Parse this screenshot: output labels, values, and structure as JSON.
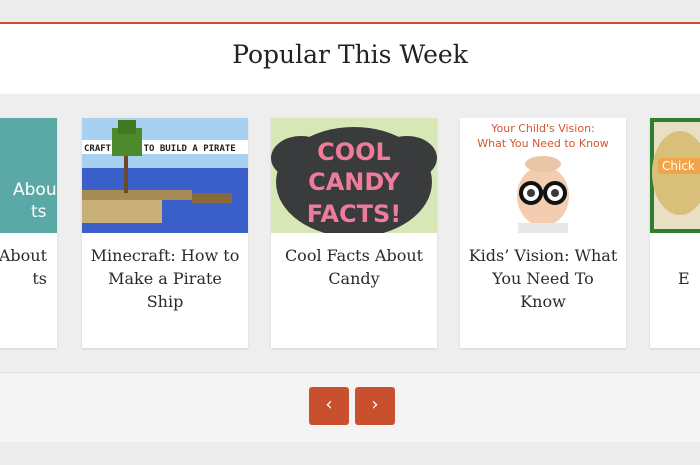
{
  "widget": {
    "title": "Popular This Week",
    "accent_color": "#c8502e"
  },
  "cards": [
    {
      "title": "... About ...ts",
      "thumb_text": "About\nts",
      "thumb_icon": "teal-banner-image"
    },
    {
      "title": "Minecraft: How to Make a Pirate Ship",
      "thumb_text": "CRAFT: HOW TO BUILD A PIRATE",
      "thumb_icon": "minecraft-island-image"
    },
    {
      "title": "Cool Facts About Candy",
      "thumb_text": "COOL CANDY FACTS!",
      "thumb_icon": "candy-facts-image"
    },
    {
      "title": "Kids’ Vision: What You Need To Know",
      "thumb_text": "Your Child's Vision: What You Need to Know",
      "thumb_icon": "child-glasses-image"
    },
    {
      "title": "...E...",
      "thumb_text": "Chick",
      "thumb_icon": "food-image"
    }
  ],
  "controls": {
    "prev_label": "‹",
    "next_label": "›"
  }
}
